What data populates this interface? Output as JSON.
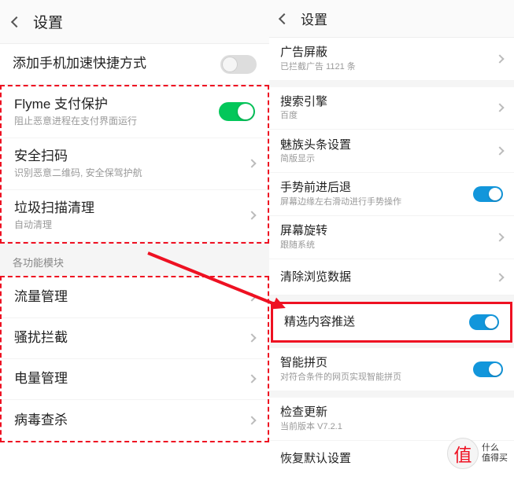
{
  "left": {
    "header": "设置",
    "add_shortcut": "添加手机加速快捷方式",
    "group1": [
      {
        "title": "Flyme 支付保护",
        "sub": "阻止恶意进程在支付界面运行",
        "ctrl": "toggle-green"
      },
      {
        "title": "安全扫码",
        "sub": "识别恶意二维码, 安全保驾护航",
        "ctrl": "chevron"
      },
      {
        "title": "垃圾扫描清理",
        "sub": "自动清理",
        "ctrl": "chevron"
      }
    ],
    "section_label": "各功能模块",
    "group2": [
      {
        "title": "流量管理"
      },
      {
        "title": "骚扰拦截"
      },
      {
        "title": "电量管理"
      },
      {
        "title": "病毒查杀"
      }
    ]
  },
  "right": {
    "header": "设置",
    "ad_block": {
      "title": "广告屏蔽",
      "sub": "已拦截广告 1121 条"
    },
    "group_a": [
      {
        "title": "搜索引擎",
        "sub": "百度",
        "ctrl": "chevron"
      },
      {
        "title": "魅族头条设置",
        "sub": "简版显示",
        "ctrl": "chevron"
      },
      {
        "title": "手势前进后退",
        "sub": "屏幕边缘左右滑动进行手势操作",
        "ctrl": "toggle-blue"
      },
      {
        "title": "屏幕旋转",
        "sub": "跟随系统",
        "ctrl": "chevron"
      },
      {
        "title": "清除浏览数据",
        "ctrl": "chevron"
      }
    ],
    "featured": {
      "title": "精选内容推送",
      "ctrl": "toggle-blue"
    },
    "smart": {
      "title": "智能拼页",
      "sub": "对符合条件的网页实现智能拼页",
      "ctrl": "toggle-blue"
    },
    "tail": [
      {
        "title": "检查更新",
        "sub": "当前版本 V7.2.1"
      },
      {
        "title": "恢复默认设置"
      }
    ]
  },
  "watermark": {
    "line1": "值",
    "line2_a": "什么",
    "line2_b": "值得买"
  }
}
